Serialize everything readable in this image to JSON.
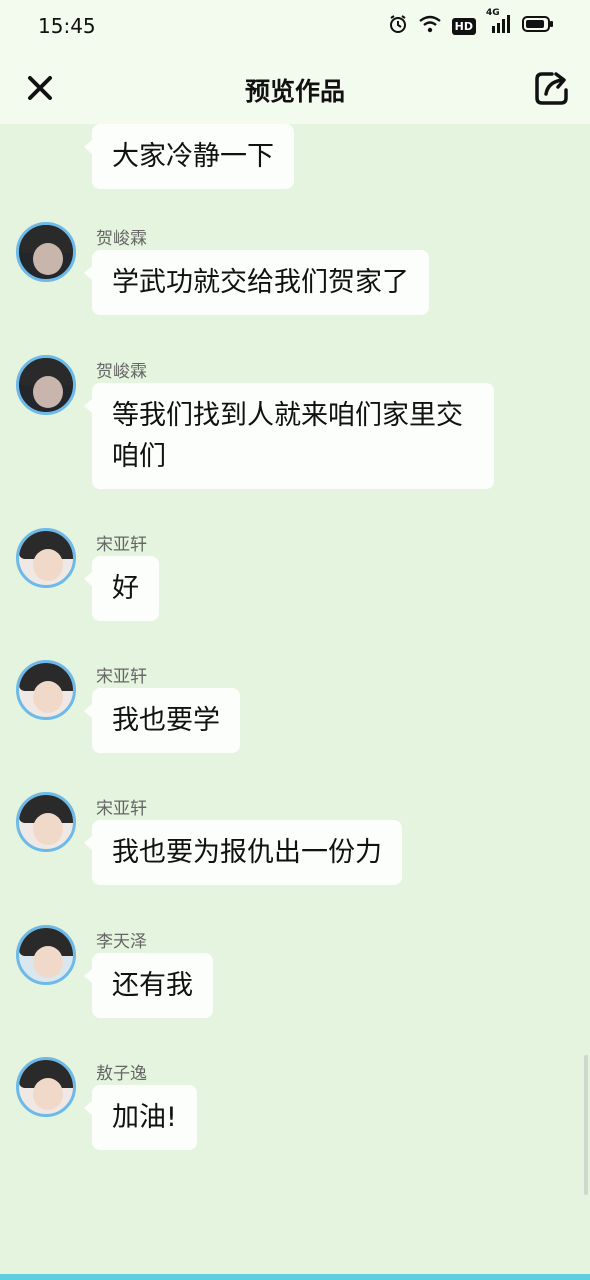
{
  "status_bar": {
    "time": "15:45",
    "hd_label": "HD",
    "network_label": "4G"
  },
  "header": {
    "title": "预览作品"
  },
  "messages": [
    {
      "name": "",
      "text": "大家冷静一下"
    },
    {
      "name": "贺峻霖",
      "text": "学武功就交给我们贺家了"
    },
    {
      "name": "贺峻霖",
      "text": "等我们找到人就来咱们家里交咱们"
    },
    {
      "name": "宋亚轩",
      "text": "好"
    },
    {
      "name": "宋亚轩",
      "text": "我也要学"
    },
    {
      "name": "宋亚轩",
      "text": "我也要为报仇出一份力"
    },
    {
      "name": "李天泽",
      "text": "还有我"
    },
    {
      "name": "敖子逸",
      "text": "加油!"
    }
  ],
  "colors": {
    "background": "#e5f4df",
    "bubble": "#fbfefb",
    "avatar_ring": "#6cb9ea"
  },
  "icons": [
    "close-icon",
    "share-icon",
    "alarm-icon",
    "wifi-icon",
    "signal-icon",
    "battery-icon"
  ]
}
